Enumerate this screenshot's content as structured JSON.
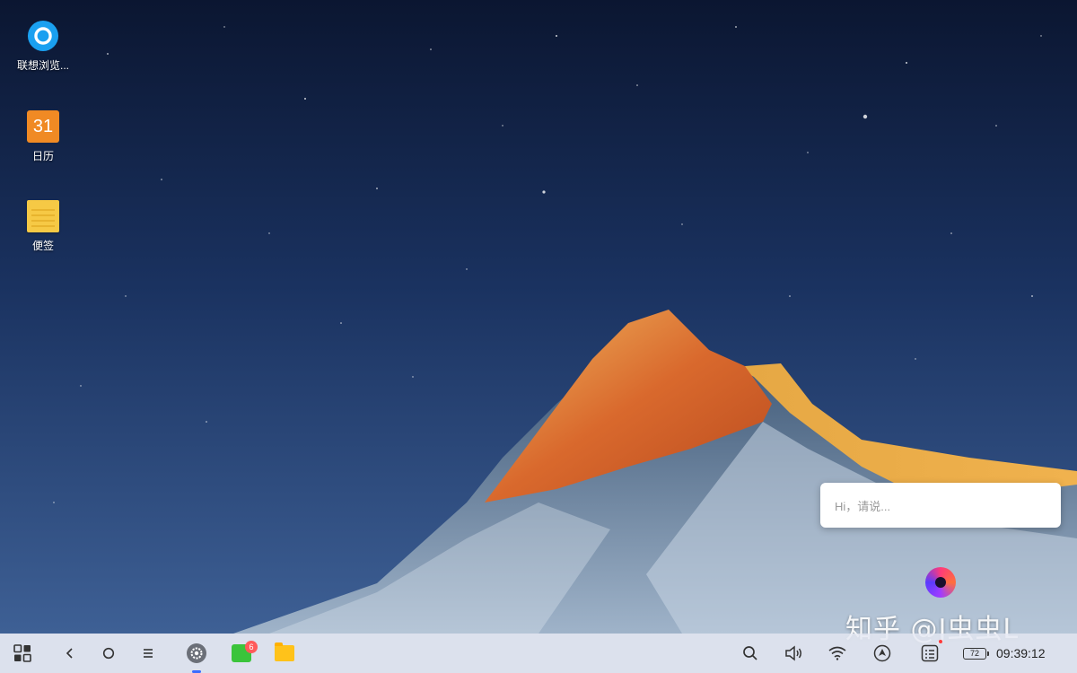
{
  "desktop": {
    "icons": [
      {
        "label": "联想浏览...",
        "icon": "browser-icon"
      },
      {
        "label": "日历",
        "icon": "calendar-icon",
        "glyph": "31"
      },
      {
        "label": "便签",
        "icon": "notes-icon"
      }
    ]
  },
  "assistant": {
    "placeholder": "Hi，请说..."
  },
  "watermark": "知乎 @J虫虫L",
  "taskbar": {
    "start": "start-menu-icon",
    "nav": [
      "back-icon",
      "home-icon",
      "recents-icon"
    ],
    "apps": [
      {
        "name": "settings-app",
        "badge": ""
      },
      {
        "name": "messages-app",
        "badge": "6"
      },
      {
        "name": "files-app",
        "badge": ""
      }
    ],
    "tray": {
      "battery": "72",
      "clock": "09:39:12"
    }
  },
  "colors": {
    "accent": "#3b6cff",
    "badge": "#ff5a5a",
    "calendar": "#f08a24",
    "notes": "#f6c945",
    "messages": "#3bc43b",
    "files": "#ffc21a"
  }
}
